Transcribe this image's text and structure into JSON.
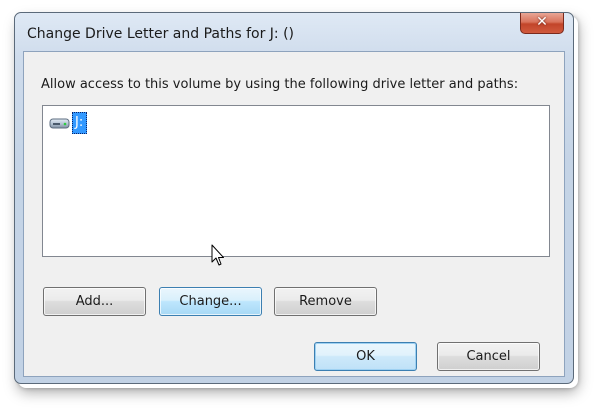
{
  "window": {
    "title": "Change Drive Letter and Paths for J: ()",
    "close_glyph": "✕"
  },
  "dialog": {
    "instruction": "Allow access to this volume by using the following drive letter and paths:",
    "list_items": [
      {
        "label": "J:",
        "icon": "drive-icon",
        "selected": true
      }
    ],
    "buttons": {
      "add": "Add...",
      "change": "Change...",
      "remove": "Remove",
      "ok": "OK",
      "cancel": "Cancel"
    }
  },
  "colors": {
    "selection": "#3399ff",
    "close_button": "#c2452a",
    "button_hover_border": "#3c7fb1"
  }
}
